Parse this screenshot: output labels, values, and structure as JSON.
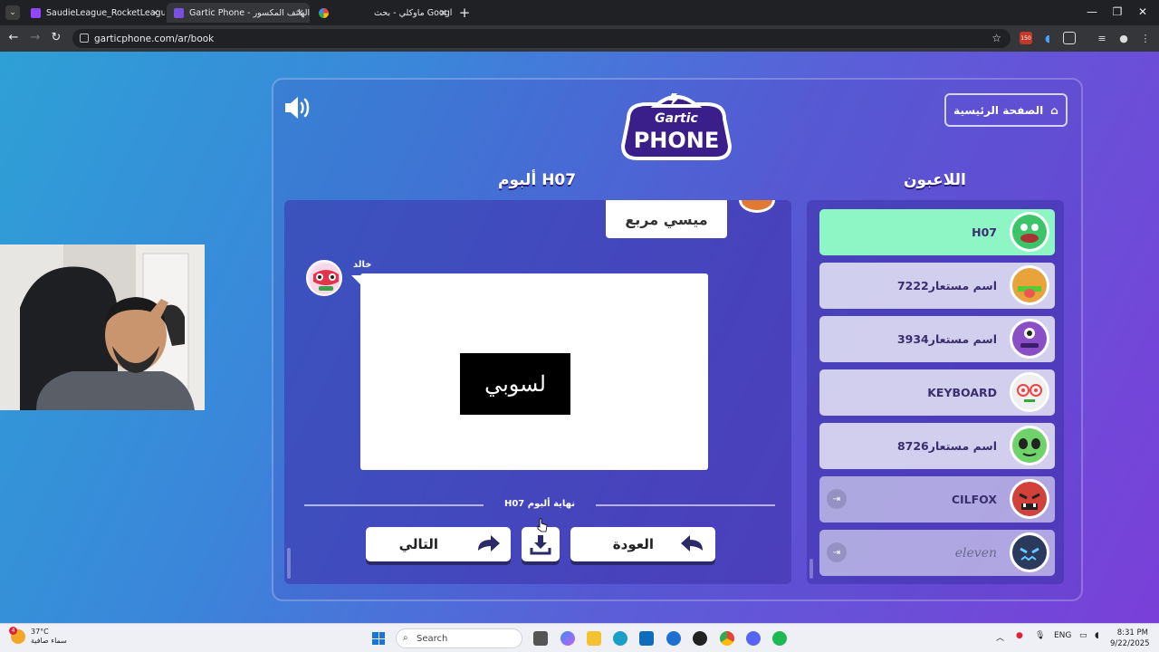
{
  "browser": {
    "tabs": [
      {
        "title": "SaudieLeague_RocketLeague",
        "active": false
      },
      {
        "title": "Gartic Phone - الهاتف المكسور",
        "active": true
      },
      {
        "title": "ماوكلي - بحث Google",
        "active": false
      }
    ],
    "url": "garticphone.com/ar/book",
    "extension_badge": "150"
  },
  "game": {
    "logo_top": "Gartic",
    "logo_bottom": "PHONE",
    "home_button": "الصفحة الرئيسية",
    "album_title": "ألبوم H07",
    "players_title": "اللاعبون",
    "prompt_text": "ميسي مربع",
    "drawer_name": "خالد",
    "drawing_text": "لسوبي",
    "end_of_album": "نهاية ألبوم H07",
    "buttons": {
      "next": "التالي",
      "back": "العودة"
    },
    "players": [
      {
        "name": "H07",
        "status": "active",
        "color": "#3cc46a"
      },
      {
        "name": "اسم مستعار7222",
        "status": "normal",
        "color": "#e8a33a"
      },
      {
        "name": "اسم مستعار3934",
        "status": "normal",
        "color": "#8a4fc6"
      },
      {
        "name": "KEYBOARD",
        "status": "normal",
        "color": "#f0f0f0"
      },
      {
        "name": "اسم مستعار8726",
        "status": "normal",
        "color": "#6fd36a"
      },
      {
        "name": "CILFOX",
        "status": "left",
        "color": "#d2413a"
      },
      {
        "name": "eleven",
        "status": "left",
        "color": "#2b3a5c"
      }
    ]
  },
  "taskbar": {
    "weather_temp": "37°C",
    "weather_desc": "سماء صافية",
    "weather_badge": "4",
    "search_placeholder": "Search",
    "language": "ENG",
    "time": "8:31 PM",
    "date": "9/22/2025"
  }
}
